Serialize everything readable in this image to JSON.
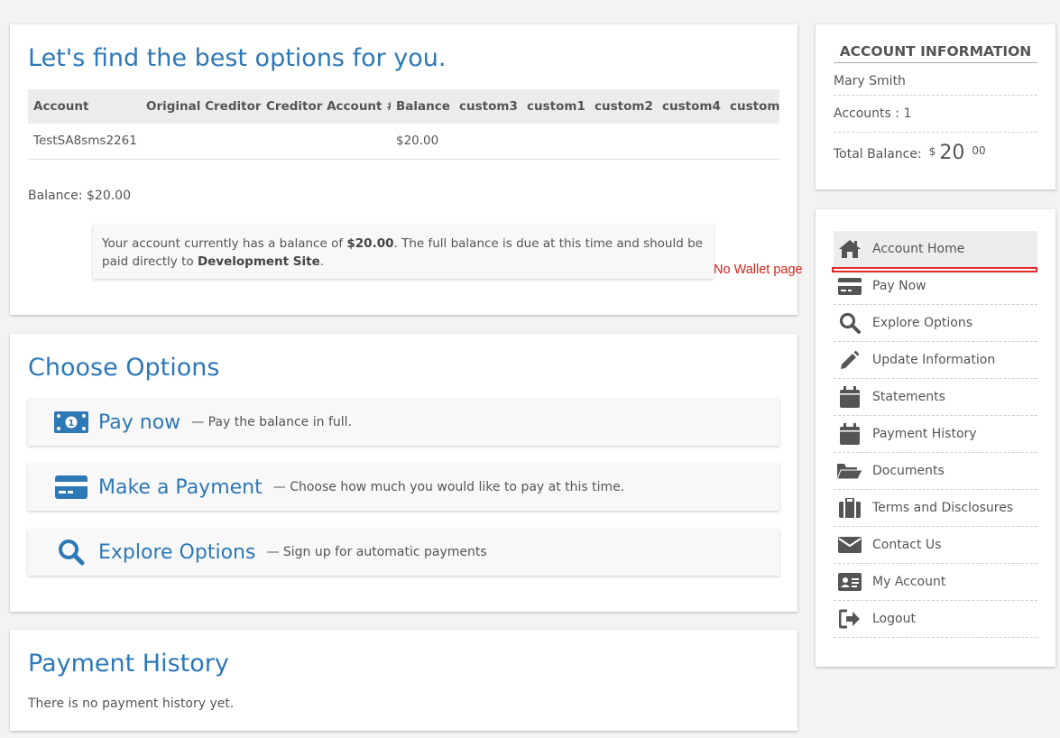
{
  "card1": {
    "heading": "Let's find the best options for you.",
    "table": {
      "headers": [
        "Account",
        "Original Creditor",
        "Creditor Account #",
        "Balance",
        "custom3",
        "custom1",
        "custom2",
        "custom4",
        "custom"
      ],
      "rows": [
        [
          "TestSA8sms2261",
          "",
          "",
          "$20.00",
          "",
          "",
          "",
          "",
          ""
        ]
      ]
    },
    "balance_line": "Balance: $20.00",
    "notice": {
      "text_before": "Your account currently has a balance of ",
      "amount": "$20.00",
      "text_middle": ". The full balance is due at this time and should be paid directly to ",
      "site": "Development Site",
      "text_end": "."
    }
  },
  "options": {
    "heading": "Choose Options",
    "items": [
      {
        "title": "Pay now",
        "desc": "— Pay the balance in full.",
        "icon": "money-bill-icon"
      },
      {
        "title": "Make a Payment",
        "desc": "— Choose how much you would like to pay at this time.",
        "icon": "credit-card-icon"
      },
      {
        "title": "Explore Options",
        "desc": "— Sign up for automatic payments",
        "icon": "search-icon"
      }
    ]
  },
  "history": {
    "heading": "Payment History",
    "empty_text": "There is no payment history yet."
  },
  "account_info": {
    "heading": "ACCOUNT INFORMATION",
    "name": "Mary Smith",
    "accounts": "Accounts : 1",
    "total_label": "Total Balance:",
    "currency": "$",
    "dollars": "20",
    "cents": "00"
  },
  "nav": {
    "items": [
      {
        "label": "Account Home",
        "icon": "home-icon",
        "active": true
      },
      {
        "label": "Pay Now",
        "icon": "credit-card-icon"
      },
      {
        "label": "Explore Options",
        "icon": "search-icon"
      },
      {
        "label": "Update Information",
        "icon": "pencil-icon"
      },
      {
        "label": "Statements",
        "icon": "calendar-icon"
      },
      {
        "label": "Payment History",
        "icon": "calendar-icon"
      },
      {
        "label": "Documents",
        "icon": "folder-open-icon"
      },
      {
        "label": "Terms and Disclosures",
        "icon": "suitcase-icon"
      },
      {
        "label": "Contact Us",
        "icon": "envelope-icon"
      },
      {
        "label": "My Account",
        "icon": "id-card-icon"
      },
      {
        "label": "Logout",
        "icon": "sign-out-icon"
      }
    ]
  },
  "annotation": "No Wallet page",
  "colors": {
    "accent": "#2d78b7",
    "annotation": "#d0241a",
    "icon": "#555555"
  }
}
